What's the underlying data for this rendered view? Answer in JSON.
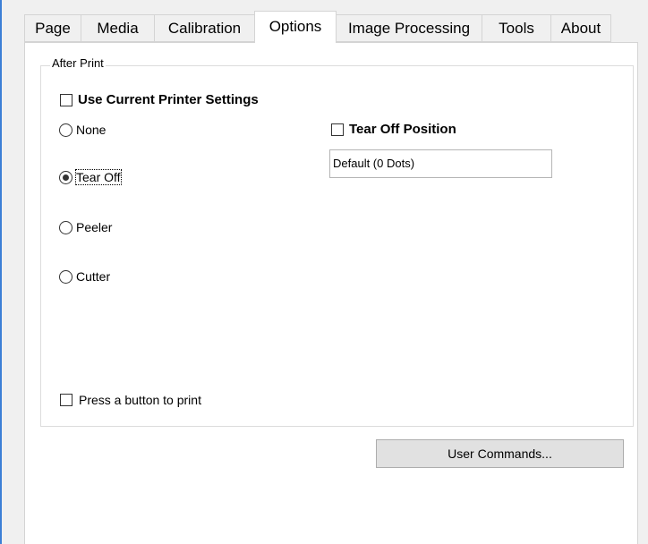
{
  "tabs": [
    {
      "label": "Page"
    },
    {
      "label": "Media"
    },
    {
      "label": "Calibration"
    },
    {
      "label": "Options"
    },
    {
      "label": "Image Processing"
    },
    {
      "label": "Tools"
    },
    {
      "label": "About"
    }
  ],
  "active_tab": "Options",
  "after_print": {
    "legend": "After Print",
    "use_current_printer_settings": {
      "label": "Use Current Printer Settings",
      "checked": false
    },
    "options": [
      {
        "label": "None",
        "selected": false
      },
      {
        "label": "Tear Off",
        "selected": true
      },
      {
        "label": "Peeler",
        "selected": false
      },
      {
        "label": "Cutter",
        "selected": false
      }
    ],
    "tear_off_position": {
      "label": "Tear Off Position",
      "checked": false,
      "value": "Default (0 Dots)"
    },
    "press_button_to_print": {
      "label": "Press a button to print",
      "checked": false
    }
  },
  "user_commands_button": "User Commands..."
}
